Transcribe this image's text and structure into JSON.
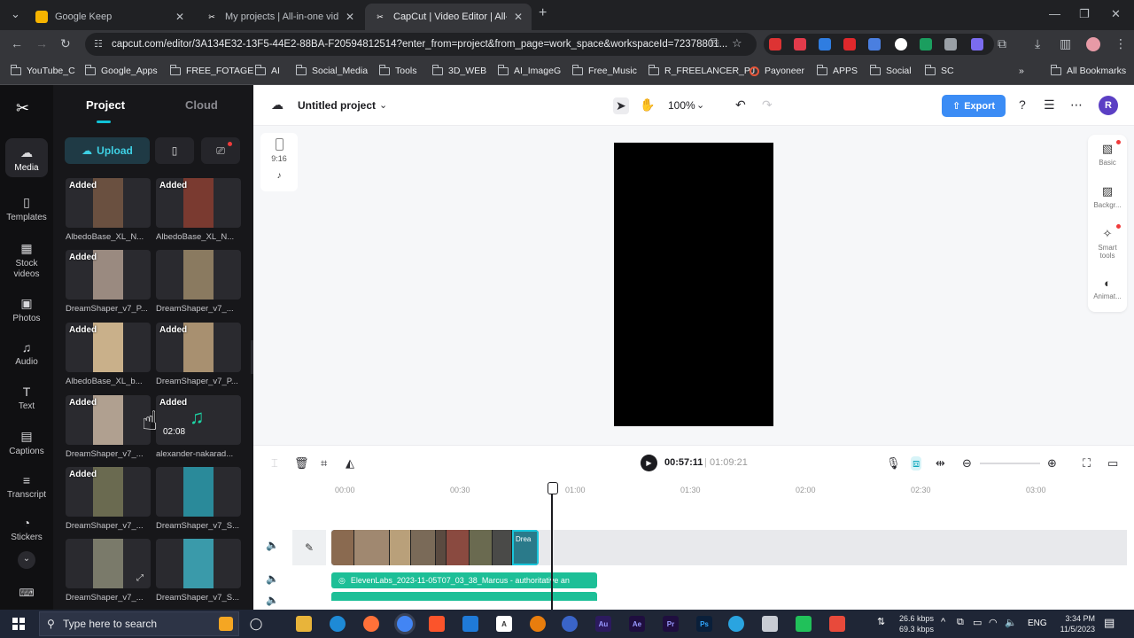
{
  "browser": {
    "tabs": [
      {
        "title": "Google Keep",
        "fav_color": "#f6b400"
      },
      {
        "title": "My projects | All-in-one video",
        "fav_color": "#ffffff"
      },
      {
        "title": "CapCut | Video Editor | All-In-",
        "fav_color": "#ffffff"
      }
    ],
    "url": "capcut.com/editor/3A134E32-13F5-44E2-88BA-F20594812514?enter_from=project&from_page=work_space&workspaceId=72378801...",
    "bookmarks": [
      "YouTube_C",
      "Google_Apps",
      "FREE_FOTAGE",
      "AI",
      "Social_Media",
      "Tools",
      "3D_WEB",
      "AI_ImageG",
      "Free_Music",
      "R_FREELANCER_PJ",
      "Payoneer",
      "APPS",
      "Social",
      "SC"
    ],
    "all_bookmarks": "All Bookmarks"
  },
  "nav": [
    {
      "label": "Media",
      "icon": "cloud-upload-icon"
    },
    {
      "label": "Templates",
      "icon": "templates-icon"
    },
    {
      "label": "Stock videos",
      "icon": "stock-videos-icon"
    },
    {
      "label": "Photos",
      "icon": "photos-icon"
    },
    {
      "label": "Audio",
      "icon": "audio-icon"
    },
    {
      "label": "Text",
      "icon": "text-icon"
    },
    {
      "label": "Captions",
      "icon": "captions-icon"
    },
    {
      "label": "Transcript",
      "icon": "transcript-icon"
    },
    {
      "label": "Stickers",
      "icon": "stickers-icon"
    }
  ],
  "panel": {
    "tab_project": "Project",
    "tab_cloud": "Cloud",
    "upload": "Upload",
    "added": "Added",
    "items": [
      {
        "name": "AlbedoBase_XL_N...",
        "color": "#6a5040"
      },
      {
        "name": "AlbedoBase_XL_N...",
        "color": "#7a3a30"
      },
      {
        "name": "DreamShaper_v7_P...",
        "color": "#9a8a80"
      },
      {
        "name": "DreamShaper_v7_...",
        "color": "#8a7a60"
      },
      {
        "name": "AlbedoBase_XL_b...",
        "color": "#c9b08a"
      },
      {
        "name": "DreamShaper_v7_P...",
        "color": "#a89070"
      },
      {
        "name": "DreamShaper_v7_...",
        "color": "#b0a090"
      },
      {
        "name": "alexander-nakarad...",
        "color": "#2a2a2f",
        "duration": "02:08"
      },
      {
        "name": "DreamShaper_v7_...",
        "color": "#6a6a50"
      },
      {
        "name": "DreamShaper_v7_S...",
        "color": "#2a8a9a"
      },
      {
        "name": "DreamShaper_v7_...",
        "color": "#7a7a6a"
      },
      {
        "name": "DreamShaper_v7_S...",
        "color": "#3a9aaa"
      }
    ]
  },
  "header": {
    "project_title": "Untitled project",
    "zoom": "100%",
    "export": "Export",
    "avatar": "R"
  },
  "canvas": {
    "ratio": "9:16"
  },
  "right_panel": [
    {
      "label": "Basic"
    },
    {
      "label": "Backgr..."
    },
    {
      "label": "Smart tools"
    },
    {
      "label": "Animat..."
    }
  ],
  "timeline": {
    "current_time": "00:57:11",
    "total_time": "01:09:21",
    "ticks": [
      "00:00",
      "00:30",
      "01:00",
      "01:30",
      "02:00",
      "02:30",
      "03:00"
    ],
    "last_clip_label": "Drea",
    "audio_clip": "ElevenLabs_2023-11-05T07_03_38_Marcus - authoritative an"
  },
  "taskbar": {
    "search": "Type here to search",
    "net_up": "26.6 kbps",
    "net_down": "69.3 kbps",
    "lang": "ENG",
    "time": "3:34 PM",
    "date": "11/5/2023"
  }
}
